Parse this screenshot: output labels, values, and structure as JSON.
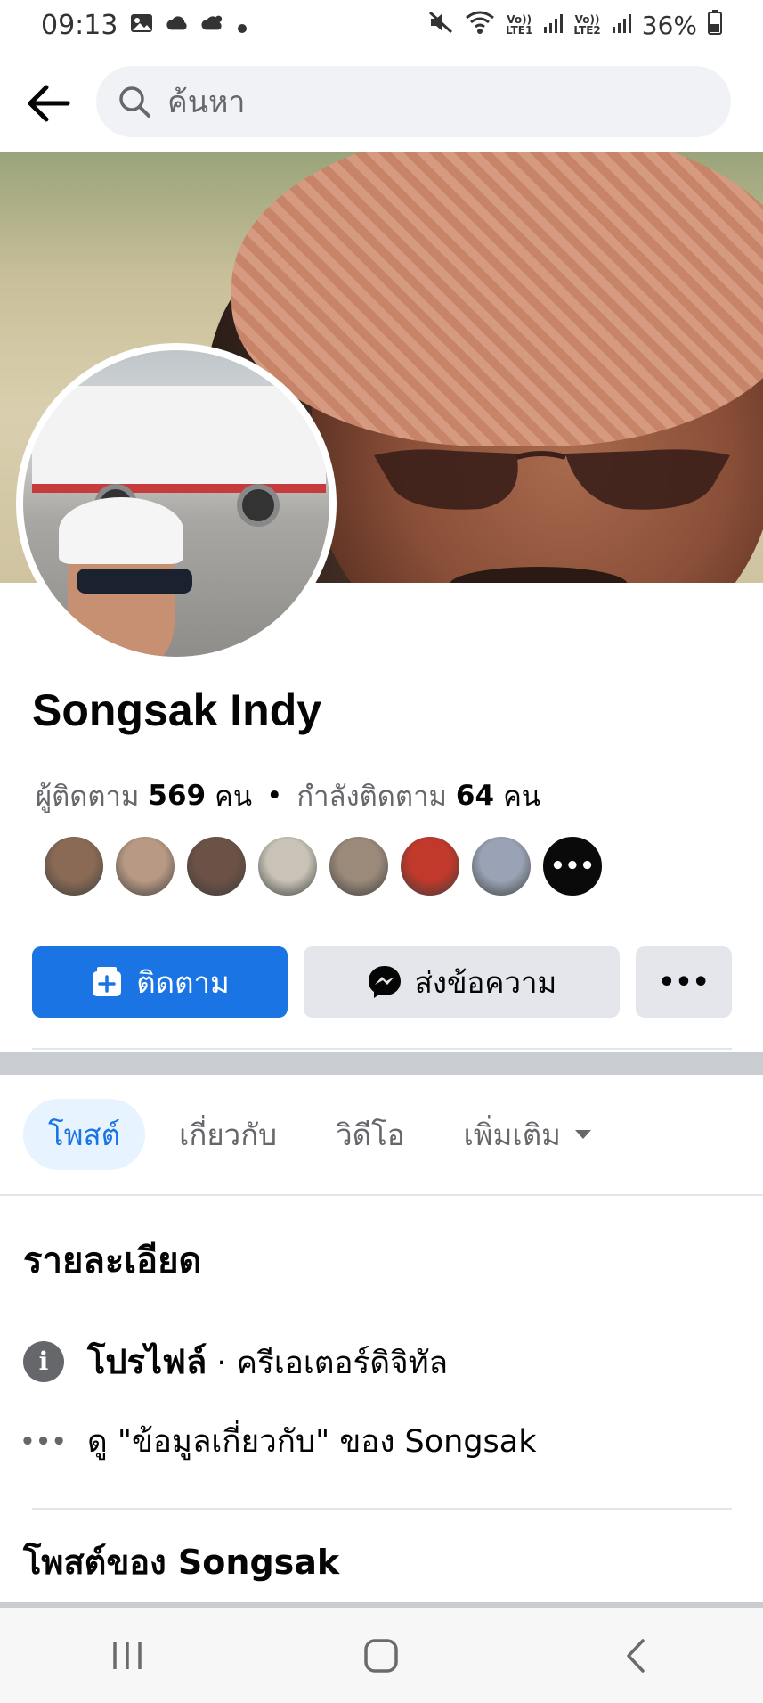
{
  "status_bar": {
    "time": "09:13",
    "battery": "36%",
    "sim1_label": "LTE1",
    "sim2_label": "LTE2",
    "volte": "Vo))"
  },
  "search": {
    "placeholder": "ค้นหา"
  },
  "profile": {
    "name": "Songsak Indy",
    "followers_label": "ผู้ติดตาม",
    "followers_count": "569",
    "followers_unit": "คน",
    "following_label": "กำลังติดตาม",
    "following_count": "64",
    "following_unit": "คน",
    "separator": "•"
  },
  "friend_avatars": {
    "colors": [
      "#8a6a55",
      "#b89a84",
      "#6c5246",
      "#c8c3b6",
      "#9b8a7a",
      "#c0392b",
      "#9aa3b5"
    ],
    "more_glyph": "•••"
  },
  "actions": {
    "follow_label": "ติดตาม",
    "message_label": "ส่งข้อความ",
    "more_glyph": "•••"
  },
  "tabs": [
    {
      "label": "โพสต์",
      "active": true
    },
    {
      "label": "เกี่ยวกับ",
      "active": false
    },
    {
      "label": "วิดีโอ",
      "active": false
    },
    {
      "label": "เพิ่มเติม",
      "active": false
    }
  ],
  "details": {
    "title": "รายละเอียด",
    "profile_lead": "โปรไฟล์",
    "profile_sub": "· ครีเอเตอร์ดิจิทัล",
    "about_link": "ดู \"ข้อมูลเกี่ยวกับ\" ของ Songsak",
    "info_glyph": "i",
    "dots_glyph": "•••"
  },
  "posts": {
    "title": "โพสต์ของ Songsak"
  },
  "icons": {
    "back": "arrow-left-icon",
    "search": "search-icon",
    "follow": "follow-plus-icon",
    "message": "messenger-icon",
    "tab_more": "caret-down-icon",
    "nav_recent": "recent-apps-icon",
    "nav_home": "home-icon",
    "nav_back": "nav-back-icon"
  }
}
